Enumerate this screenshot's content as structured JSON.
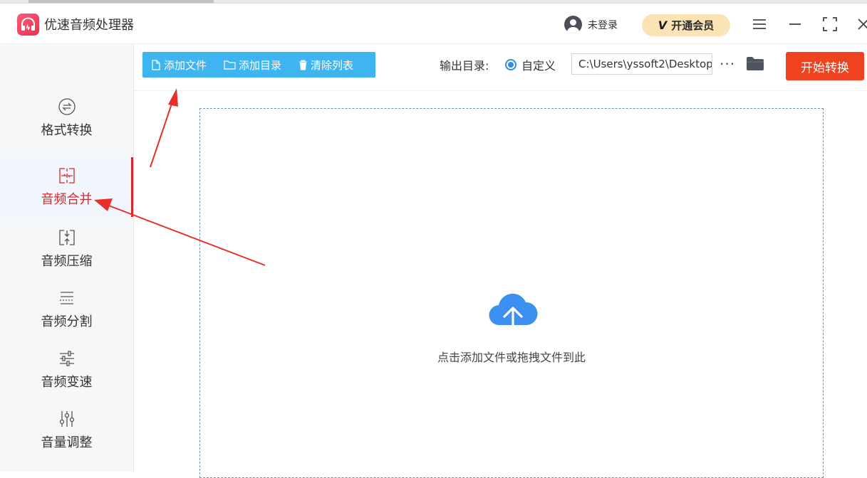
{
  "app": {
    "title": "优速音频处理器"
  },
  "user": {
    "login_label": "未登录"
  },
  "vip": {
    "mark": "V",
    "label": "开通会员"
  },
  "sidebar": {
    "items": [
      {
        "label": "格式转换",
        "icon": "format-convert-icon",
        "active": false
      },
      {
        "label": "音频合并",
        "icon": "audio-merge-icon",
        "active": true
      },
      {
        "label": "音频压缩",
        "icon": "audio-compress-icon",
        "active": false
      },
      {
        "label": "音频分割",
        "icon": "audio-split-icon",
        "active": false
      },
      {
        "label": "音频变速",
        "icon": "audio-speed-icon",
        "active": false
      },
      {
        "label": "音量调整",
        "icon": "volume-adjust-icon",
        "active": false
      }
    ]
  },
  "toolbar": {
    "add_file": "添加文件",
    "add_dir": "添加目录",
    "clear_list": "清除列表"
  },
  "output": {
    "label": "输出目录:",
    "mode": "自定义",
    "path": "C:\\Users\\yssoft2\\Desktop",
    "more": "···"
  },
  "start_button": "开始转换",
  "dropzone": {
    "text": "点击添加文件或拖拽文件到此"
  },
  "colors": {
    "accent_blue": "#3eb5f0",
    "start_red": "#f0421e",
    "active_red": "#d8282f",
    "annotation_red": "#e8302a",
    "cloud_blue": "#3d8ff0"
  }
}
